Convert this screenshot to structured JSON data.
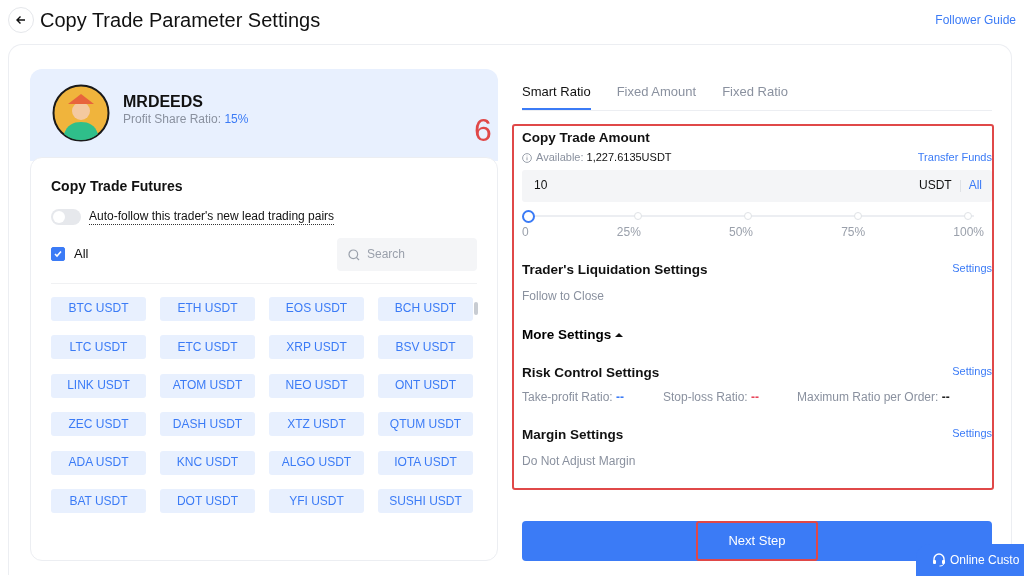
{
  "header": {
    "title": "Copy Trade Parameter Settings",
    "guide_link": "Follower Guide"
  },
  "trader": {
    "name": "MRDEEDS",
    "profit_label": "Profit Share Ratio:",
    "profit_value": "15%"
  },
  "futures": {
    "title": "Copy Trade Futures",
    "auto_follow": {
      "label": "Auto-follow this trader's new lead trading pairs",
      "on": false
    },
    "select_all": {
      "label": "All",
      "checked": true
    },
    "search": {
      "placeholder": "Search"
    },
    "pairs": [
      "BTC USDT",
      "ETH USDT",
      "EOS USDT",
      "BCH USDT",
      "LTC USDT",
      "ETC USDT",
      "XRP USDT",
      "BSV USDT",
      "LINK USDT",
      "ATOM USDT",
      "NEO USDT",
      "ONT USDT",
      "ZEC USDT",
      "DASH USDT",
      "XTZ USDT",
      "QTUM USDT",
      "ADA USDT",
      "KNC USDT",
      "ALGO USDT",
      "IOTA USDT",
      "BAT USDT",
      "DOT USDT",
      "YFI USDT",
      "SUSHI USDT"
    ]
  },
  "tabs": [
    {
      "label": "Smart Ratio",
      "selected": true
    },
    {
      "label": "Fixed Amount",
      "selected": false
    },
    {
      "label": "Fixed Ratio",
      "selected": false
    }
  ],
  "annotation": "6",
  "amount": {
    "title": "Copy Trade Amount",
    "available_label": "Available:",
    "available_value": "1,227.6135USDT",
    "transfer_link": "Transfer Funds",
    "value": "10",
    "unit": "USDT",
    "all_link": "All",
    "level": 0,
    "ticks": [
      "0",
      "25%",
      "50%",
      "75%",
      "100%"
    ]
  },
  "liquidation": {
    "title": "Trader's Liquidation Settings",
    "link": "Settings",
    "value": "Follow to Close"
  },
  "more_settings": {
    "label": "More Settings",
    "expanded": true
  },
  "risk": {
    "title": "Risk Control Settings",
    "link": "Settings",
    "items": [
      {
        "label": "Take-profit Ratio:",
        "value": "--",
        "color": "#3b7bf6"
      },
      {
        "label": "Stop-loss Ratio:",
        "value": "--",
        "color": "#e8455a"
      },
      {
        "label": "Maximum Ratio per Order:",
        "value": "--",
        "color": "#222222"
      }
    ]
  },
  "margin": {
    "title": "Margin Settings",
    "link": "Settings",
    "value": "Do Not Adjust Margin"
  },
  "next_button": "Next Step",
  "support": "Online Custo"
}
